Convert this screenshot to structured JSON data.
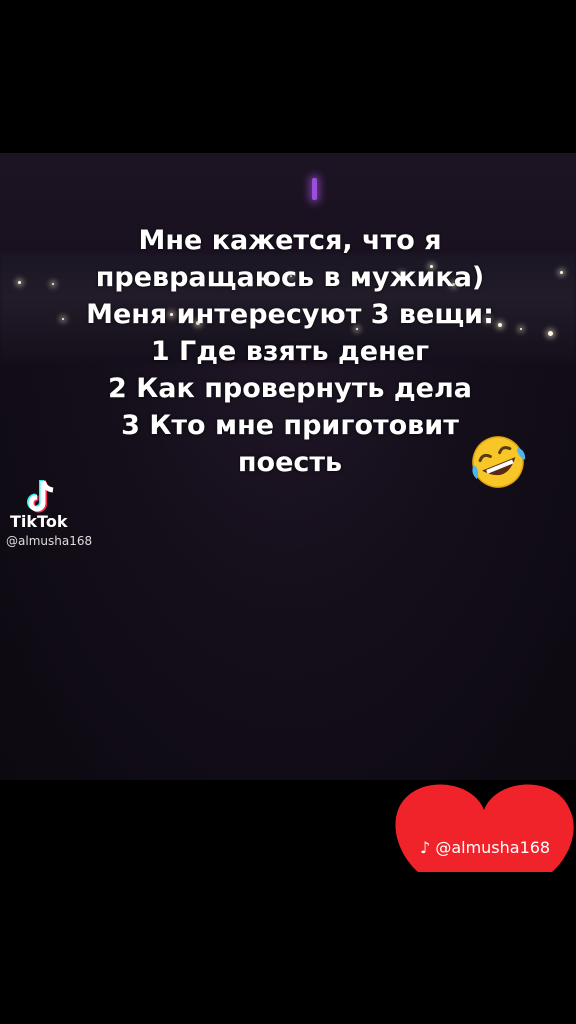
{
  "caption": {
    "lines": [
      "Мне кажется, что я",
      "превращаюсь в мужика)",
      "Меня интересуют 3 вещи:",
      "1 Где взять денег",
      "2 Как провернуть дела",
      "3 Кто мне приготовит",
      "поесть"
    ]
  },
  "overlay": {
    "tiktok_wordmark": "TikTok",
    "tiktok_username": "@almusha168",
    "heart_watermark": "@almusha168"
  },
  "icons": {
    "tiktok_logo": "tiktok-logo-icon",
    "emoji": "rolling-on-floor-laughing-emoji",
    "heart": "red-heart-icon"
  },
  "colors": {
    "heart": "#f0232b",
    "background": "#000000",
    "caption_text": "#ffffff"
  }
}
